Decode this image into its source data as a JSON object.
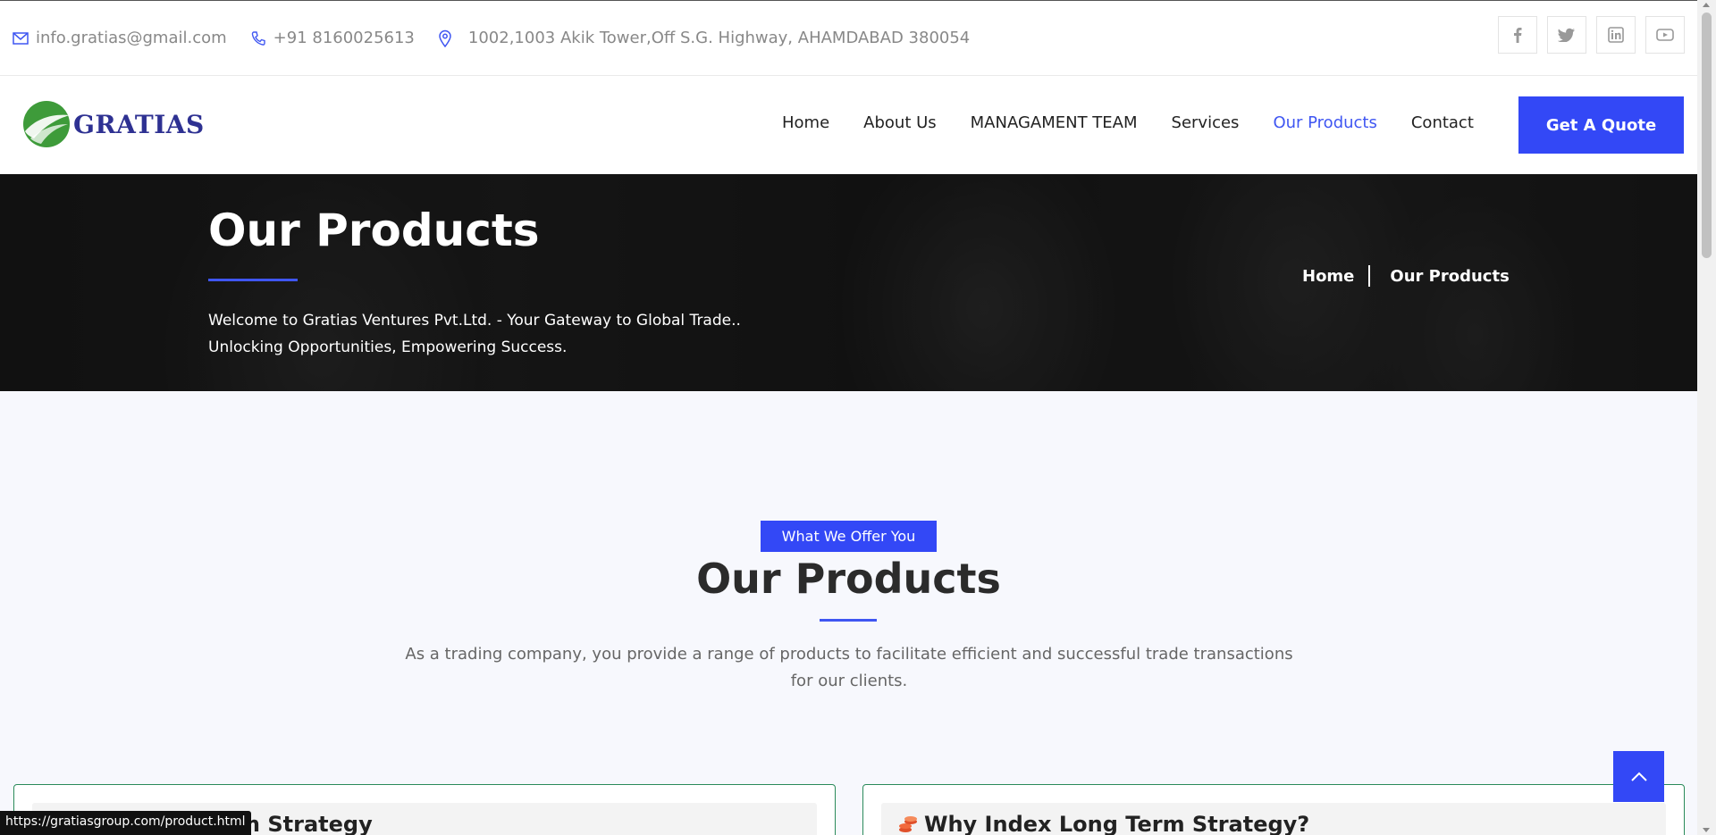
{
  "topbar": {
    "email": "info.gratias@gmail.com",
    "phone": "+91 8160025613",
    "address": "1002,1003 Akik Tower,Off S.G. Highway, AHAMDABAD 380054",
    "socials": [
      "facebook-icon",
      "twitter-icon",
      "linkedin-icon",
      "youtube-icon"
    ]
  },
  "brand": {
    "name": "GRATIAS",
    "color": "#2e3192"
  },
  "nav": {
    "items": [
      {
        "label": "Home"
      },
      {
        "label": "About Us"
      },
      {
        "label": "MANAGAMENT TEAM"
      },
      {
        "label": "Services"
      },
      {
        "label": "Our Products",
        "active": true
      },
      {
        "label": "Contact"
      }
    ],
    "cta": "Get A Quote"
  },
  "hero": {
    "title": "Our Products",
    "welcome_line1": "Welcome to Gratias Ventures Pvt.Ltd. - Your Gateway to Global Trade..",
    "welcome_line2": "Unlocking Opportunities, Empowering Success.",
    "breadcrumb": [
      "Home",
      "Our Products"
    ]
  },
  "section": {
    "badge": "What We Offer You",
    "title": "Our Products",
    "description_line1": "As a trading company, you provide a range of products to facilitate efficient and successful trade transactions",
    "description_line2": "for our clients."
  },
  "cards": [
    {
      "title": "m Strategy"
    },
    {
      "title": "Why Index Long Term Strategy?"
    }
  ],
  "status_url": "https://gratiasgroup.com/product.html",
  "colors": {
    "accent": "#3348f6",
    "card_border": "#2a8a5a"
  }
}
